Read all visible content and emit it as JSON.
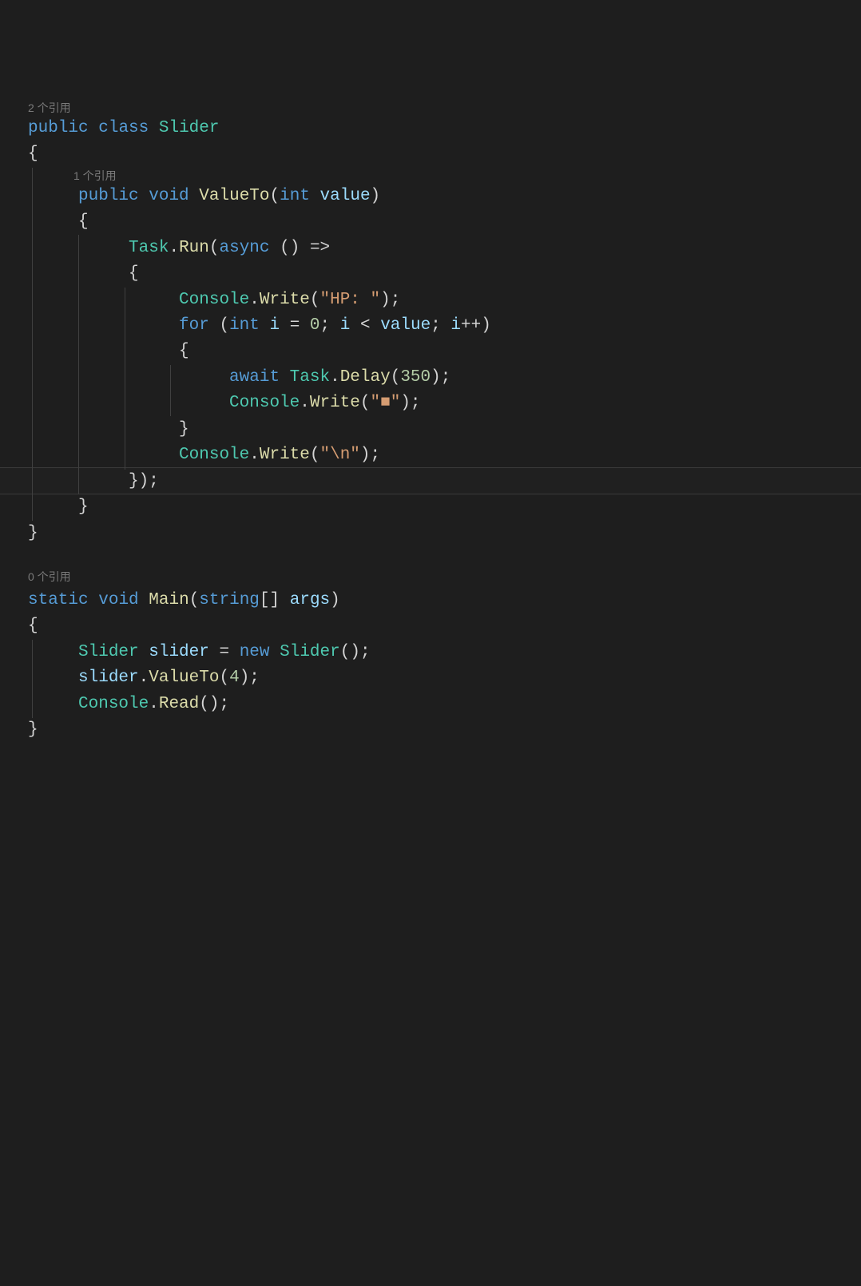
{
  "codelens": {
    "top": "2 个引用",
    "valueTo": "1 个引用",
    "main": "0 个引用"
  },
  "tokens": {
    "public": "public",
    "class": "class",
    "Slider": "Slider",
    "void": "void",
    "ValueTo": "ValueTo",
    "int": "int",
    "value": "value",
    "Task": "Task",
    "Run": "Run",
    "async": "async",
    "lambdaArrow": "=>",
    "Console": "Console",
    "Write": "Write",
    "strHP": "\"HP: \"",
    "for": "for",
    "i": "i",
    "zero": "0",
    "lt": "<",
    "inc": "++",
    "await": "await",
    "Delay": "Delay",
    "n350": "350",
    "strSquare": "\"■\"",
    "strNl": "\"\\n\"",
    "static": "static",
    "Main": "Main",
    "string": "string",
    "brackets": "[]",
    "args": "args",
    "slider": "slider",
    "eq": "=",
    "new": "new",
    "n4": "4",
    "Read": "Read",
    "openParen": "(",
    "closeParen": ")",
    "openBrace": "{",
    "closeBrace": "}",
    "semicolon": ";",
    "comma": ",",
    "dot": ".",
    "emptyParens": "()"
  }
}
